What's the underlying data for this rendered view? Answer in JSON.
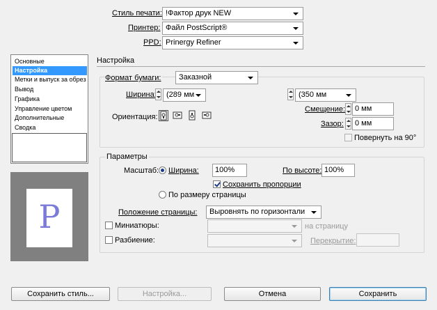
{
  "top": {
    "print_style_label": "Стиль печати:",
    "print_style_value": "!Фактор друк NEW",
    "printer_label": "Принтер:",
    "printer_value": "Файл PostScript®",
    "ppd_label": "PPD:",
    "ppd_value": "Prinergy Refiner"
  },
  "sidebar": {
    "items": [
      {
        "label": "Основные",
        "selected": false
      },
      {
        "label": "Настройка",
        "selected": true
      },
      {
        "label": "Метки и выпуск за обрез",
        "selected": false
      },
      {
        "label": "Вывод",
        "selected": false
      },
      {
        "label": "Графика",
        "selected": false
      },
      {
        "label": "Управление цветом",
        "selected": false
      },
      {
        "label": "Дополнительные",
        "selected": false
      },
      {
        "label": "Сводка",
        "selected": false
      }
    ],
    "preview_letter": "P"
  },
  "main": {
    "section_title": "Настройка",
    "paper": {
      "format_label": "Формат бумаги:",
      "format_value": "Заказной",
      "width_label": "Ширина:",
      "width_value": "(289 мм",
      "height_value": "(350 мм",
      "orientation_label": "Ориентация:",
      "offset_label": "Смещение:",
      "offset_value": "0 мм",
      "gap_label": "Зазор:",
      "gap_value": "0 мм",
      "rotate_label": "Повернуть на 90°"
    },
    "params": {
      "title": "Параметры",
      "scale_label": "Масштаб:",
      "width_radio_label": "Ширина:",
      "width_scale_value": "100%",
      "height_scale_label": "По высоте:",
      "height_scale_value": "100%",
      "keep_proportions_label": "Сохранить пропорции",
      "fit_page_label": "По размеру страницы",
      "page_position_label": "Положение страницы:",
      "page_position_value": "Выровнять по горизонтали",
      "thumbnails_label": "Миниатюры:",
      "per_page_label": "на страницу",
      "tiling_label": "Разбиение:",
      "overlap_label": "Перекрытие:"
    }
  },
  "footer": {
    "save_style_label": "Сохранить стиль...",
    "setup_label": "Настройка...",
    "cancel_label": "Отмена",
    "save_label": "Сохранить"
  },
  "colors": {
    "selection": "#3399ff",
    "preview_bg": "#808080",
    "preview_letter": "#7a7ad8"
  }
}
